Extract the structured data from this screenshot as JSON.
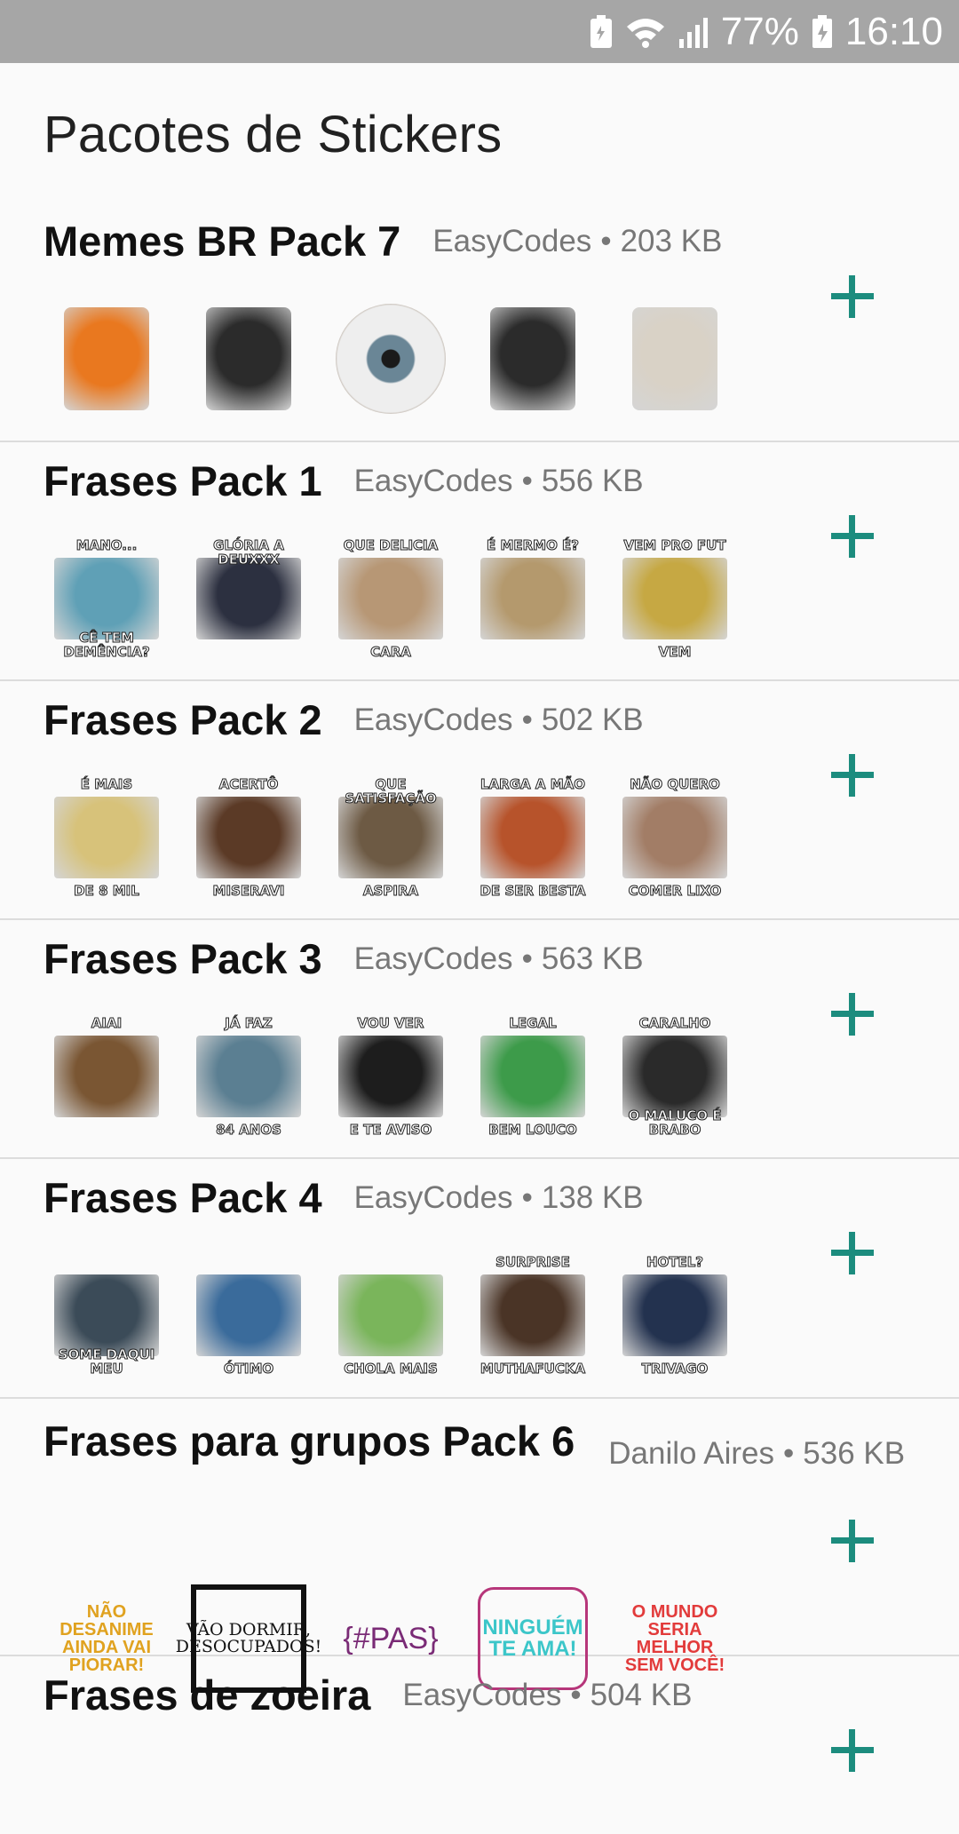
{
  "status": {
    "battery": "77%",
    "time": "16:10"
  },
  "title": "Pacotes de Stickers",
  "packs": [
    {
      "name": "Memes BR Pack 7",
      "author": "EasyCodes",
      "size": "203 KB",
      "stickers": [
        {
          "top": "",
          "bottom": "",
          "color": "#e9781f"
        },
        {
          "top": "",
          "bottom": "",
          "color": "#2b2b2b"
        },
        {
          "top": "",
          "bottom": "",
          "color": "#c9c9c5"
        },
        {
          "top": "",
          "bottom": "",
          "color": "#2b2b2b"
        },
        {
          "top": "",
          "bottom": "",
          "color": "#d9d2c6"
        }
      ]
    },
    {
      "name": "Frases Pack 1",
      "author": "EasyCodes",
      "size": "556 KB",
      "stickers": [
        {
          "top": "MANO...",
          "bottom": "CÊ TEM DEMÊNCIA?",
          "color": "#5fa0b6"
        },
        {
          "top": "GLÓRIA A DEUXXX",
          "bottom": "",
          "color": "#2c3040"
        },
        {
          "top": "QUE DELICIA",
          "bottom": "CARA",
          "color": "#b79775"
        },
        {
          "top": "É MERMO É?",
          "bottom": "",
          "color": "#b4996d"
        },
        {
          "top": "VEM PRO FUT",
          "bottom": "VEM",
          "color": "#c6a843"
        }
      ]
    },
    {
      "name": "Frases Pack 2",
      "author": "EasyCodes",
      "size": "502 KB",
      "stickers": [
        {
          "top": "É MAIS",
          "bottom": "DE 8 MIL",
          "color": "#d7c27a"
        },
        {
          "top": "ACERTÔ",
          "bottom": "MISERAVI",
          "color": "#5b3a26"
        },
        {
          "top": "QUE SATISFAÇÃO",
          "bottom": "ASPIRA",
          "color": "#6d5a44"
        },
        {
          "top": "LARGA A MÃO",
          "bottom": "DE SER BESTA",
          "color": "#b7532b"
        },
        {
          "top": "NÃO QUERO",
          "bottom": "COMER LIXO",
          "color": "#a27d66"
        }
      ]
    },
    {
      "name": "Frases Pack 3",
      "author": "EasyCodes",
      "size": "563 KB",
      "stickers": [
        {
          "top": "AIAI",
          "bottom": "",
          "color": "#7a5633"
        },
        {
          "top": "JÁ FAZ",
          "bottom": "84 ANOS",
          "color": "#5b7f92"
        },
        {
          "top": "VOU VER",
          "bottom": "E TE AVISO",
          "color": "#1d1d1d"
        },
        {
          "top": "LEGAL",
          "bottom": "BEM LOUCO",
          "color": "#3d9b4a"
        },
        {
          "top": "CARALHO",
          "bottom": "O MALUCO É BRABO",
          "color": "#2a2a2a"
        }
      ]
    },
    {
      "name": "Frases Pack 4",
      "author": "EasyCodes",
      "size": "138 KB",
      "stickers": [
        {
          "top": "",
          "bottom": "SOME DAQUI MEU",
          "color": "#3b4b58"
        },
        {
          "top": "",
          "bottom": "ÓTIMO",
          "color": "#3a6b9b"
        },
        {
          "top": "",
          "bottom": "CHOLA MAIS",
          "color": "#7ab55b"
        },
        {
          "top": "SURPRISE",
          "bottom": "MUTHAFUCKA",
          "color": "#4a3426"
        },
        {
          "top": "HOTEL?",
          "bottom": "TRIVAGO",
          "color": "#23324f"
        }
      ]
    },
    {
      "name": "Frases para grupos Pack 6",
      "author": "Danilo Aires",
      "size": "536 KB",
      "stickers": [
        {
          "text": "NÃO DESANIME AINDA VAI PIORAR!",
          "color": "#e0a21f"
        },
        {
          "text": "VÃO DORMIR, DESOCUPADOS!",
          "color": "#111111"
        },
        {
          "text": "{#PAS}",
          "color": "#7a2b76"
        },
        {
          "text": "NINGUÉM TE AMA!",
          "color": "#3cc6c9"
        },
        {
          "text": "O MUNDO SERIA MELHOR SEM VOCÊ!",
          "color": "#e23b3b"
        }
      ]
    },
    {
      "name": "Frases de zoeira",
      "author": "EasyCodes",
      "size": "504 KB",
      "stickers": []
    }
  ]
}
